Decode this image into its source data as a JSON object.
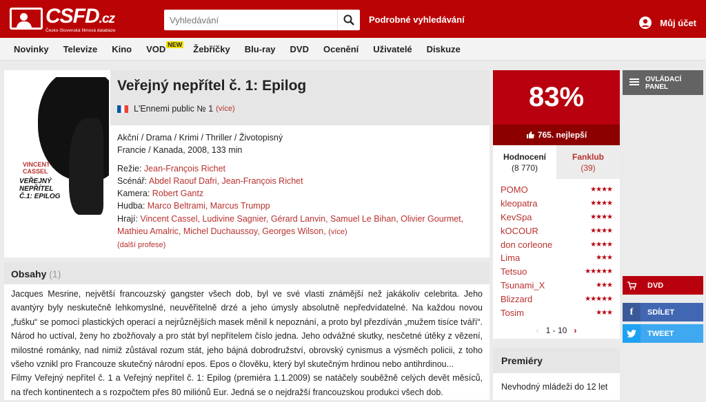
{
  "header": {
    "logo_text": "CSFD",
    "logo_suffix": ".cz",
    "logo_sub": "Česko-Slovenská filmová databáze",
    "search_placeholder": "Vyhledávání",
    "advanced_search": "Podrobné vyhledávání",
    "account": "Můj účet"
  },
  "nav": {
    "items": [
      "Novinky",
      "Televize",
      "Kino",
      "VOD",
      "Žebříčky",
      "Blu-ray",
      "DVD",
      "Ocenění",
      "Uživatelé",
      "Diskuze"
    ],
    "vod_badge": "NEW"
  },
  "movie": {
    "title": "Veřejný nepřítel č. 1: Epilog",
    "original_title": "L'Ennemi public № 1",
    "more": "(více)",
    "genres": "Akční / Drama / Krimi / Thriller / Životopisný",
    "origin": "Francie / Kanada, 2008, 133 min",
    "director_label": "Režie:",
    "director": "Jean-François Richet",
    "writer_label": "Scénář:",
    "writers": "Abdel Raouf Dafri, Jean-François Richet",
    "camera_label": "Kamera:",
    "camera": "Robert Gantz",
    "music_label": "Hudba:",
    "music": "Marco Beltrami, Marcus Trumpp",
    "cast_label": "Hrají:",
    "cast": "Vincent Cassel, Ludivine Sagnier, Gérard Lanvin, Samuel Le Bihan, Olivier Gourmet, Mathieu Amalric, Michel Duchaussoy, Georges Wilson,",
    "cast_more": "(více)",
    "more_professions": "(další profese)",
    "poster": {
      "name": "VINCENT CASSEL",
      "title": "VEŘEJNÝ NEPŘÍTEL Č.1: EPILOG"
    }
  },
  "plot": {
    "header": "Obsahy",
    "count": "(1)",
    "text1": "Jacques Mesrine, největší francouzský gangster všech dob, byl ve své vlasti známější než jakákoliv celebrita. Jeho avantýry byly neskutečně lehkomyslné, neuvěřitelně drzé a jeho úmysly absolutně nepředvídatelné. Na každou novou „fušku“ se pomocí plastických operací a nejrůznějších masek měnil k nepoznání, a proto byl přezdíván „mužem tisíce tváří“. Národ ho uctíval, ženy ho zbožňovaly a pro stát byl nepřítelem číslo jedna. Jeho odvážné skutky, nesčetné útěky z vězení, milostné románky, nad nimiž zůstával rozum stát, jeho bájná dobrodružství, obrovský cynismus a výsměch policii, z toho všeho vznikl pro Francouze skutečný národní epos. Epos o člověku, který byl skutečným hrdinou nebo antihrdinou...",
    "text2": "Filmy Veřejný nepřítel č. 1 a Veřejný nepřítel č. 1: Epilog (premiéra 1.1.2009) se natáčely souběžně celých devět měsíců, na třech kontinentech a s rozpočtem přes 80 miliónů Eur. Jedná se o nejdražší francouzskou produkci všech dob."
  },
  "rating": {
    "percent": "83%",
    "rank": "765. nejlepší",
    "tab1_label": "Hodnocení",
    "tab1_count": "(8 770)",
    "tab2_label": "Fanklub",
    "tab2_count": "(39)",
    "users": [
      {
        "name": "POMO",
        "stars": "★★★★"
      },
      {
        "name": "kleopatra",
        "stars": "★★★★"
      },
      {
        "name": "KevSpa",
        "stars": "★★★★"
      },
      {
        "name": "kOCOUR",
        "stars": "★★★★"
      },
      {
        "name": "don corleone",
        "stars": "★★★★"
      },
      {
        "name": "Lima",
        "stars": "★★★"
      },
      {
        "name": "Tetsuo",
        "stars": "★★★★★"
      },
      {
        "name": "Tsunami_X",
        "stars": "★★★"
      },
      {
        "name": "Blizzard",
        "stars": "★★★★★"
      },
      {
        "name": "Tosim",
        "stars": "★★★"
      }
    ],
    "pagination": "1 - 10"
  },
  "premiery": {
    "header": "Premiéry",
    "text": "Nevhodný mládeži do 12 let"
  },
  "side": {
    "panel": "OVLÁDACÍ PANEL",
    "dvd": "DVD",
    "share": "SDÍLET",
    "tweet": "TWEET",
    "colors": {
      "dvd": "#b8000e",
      "share": "#3b5998",
      "tweet": "#1da1f2"
    }
  }
}
